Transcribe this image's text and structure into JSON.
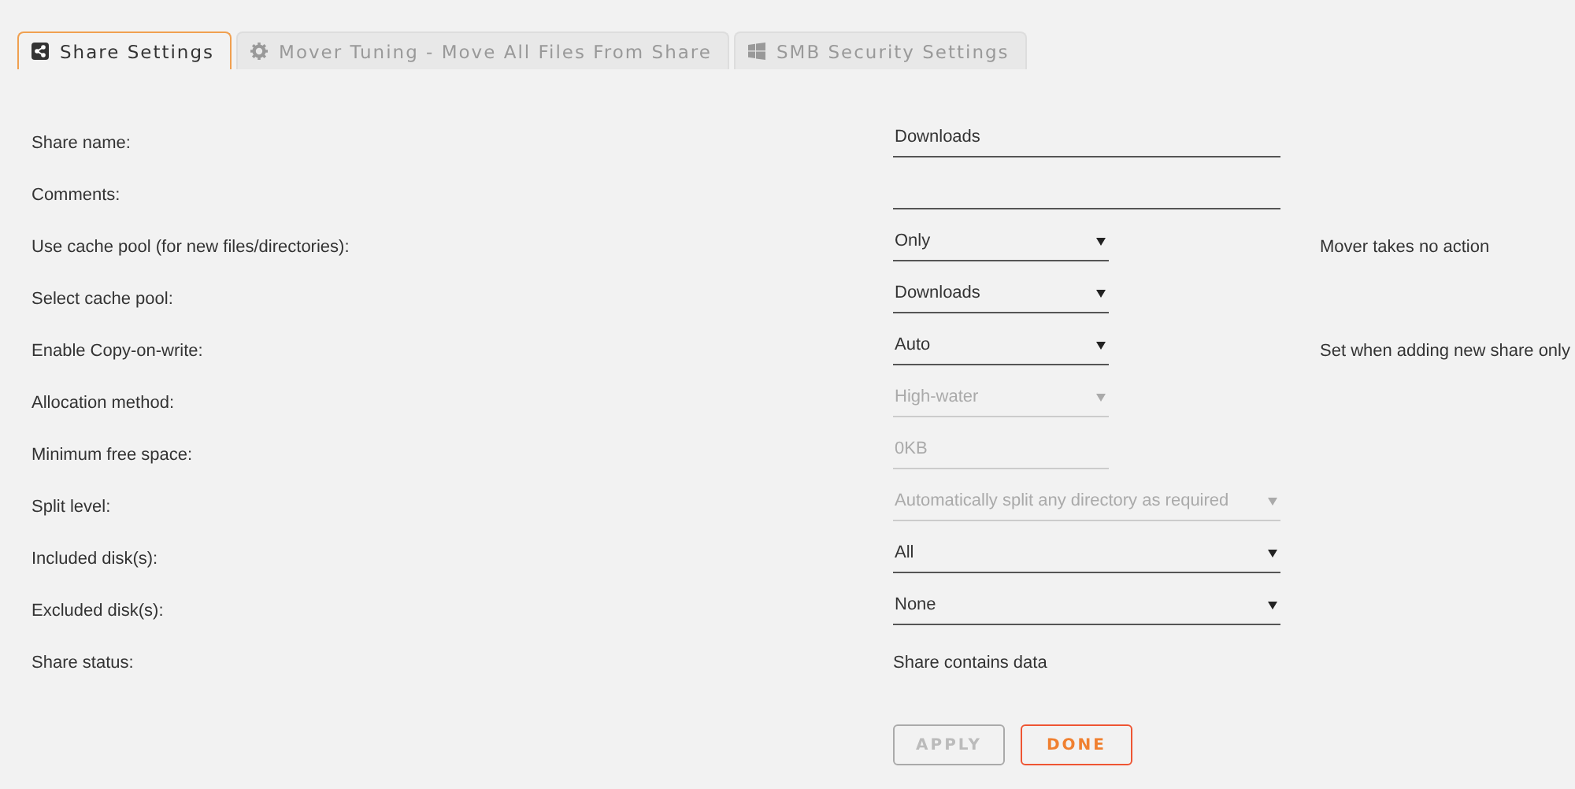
{
  "tabs": [
    {
      "label": "Share Settings",
      "selected": true
    },
    {
      "label": "Mover Tuning - Move All Files From Share",
      "selected": false
    },
    {
      "label": "SMB Security Settings",
      "selected": false
    }
  ],
  "rows": [
    {
      "label": "Share name:",
      "kind": "text",
      "value": "Downloads",
      "disabled": false
    },
    {
      "label": "Comments:",
      "kind": "text",
      "disabled": false
    },
    {
      "label": "Use cache pool (for new files/directories):",
      "kind": "select",
      "value": "Only",
      "disabled": false,
      "note": "Mover takes no action"
    },
    {
      "label": "Select cache pool:",
      "kind": "select",
      "value": "Downloads",
      "disabled": false
    },
    {
      "label": "Enable Copy-on-write:",
      "kind": "select",
      "value": "Auto",
      "disabled": false,
      "note": "Set when adding new share only"
    },
    {
      "label": "Allocation method:",
      "kind": "select",
      "value": "High-water",
      "disabled": true
    },
    {
      "label": "Minimum free space:",
      "kind": "text",
      "value": "0KB",
      "disabled": true
    },
    {
      "label": "Split level:",
      "kind": "select",
      "value": "Automatically split any directory as required",
      "disabled": true
    },
    {
      "label": "Included disk(s):",
      "kind": "select",
      "value": "All",
      "disabled": false
    },
    {
      "label": "Excluded disk(s):",
      "kind": "select",
      "value": "None",
      "disabled": false
    },
    {
      "label": "Share status:",
      "kind": "status",
      "value": "Share contains data"
    }
  ],
  "buttons": [
    {
      "label": "APPLY",
      "kind": "apply",
      "disabled": true
    },
    {
      "label": "DONE",
      "kind": "done"
    }
  ]
}
